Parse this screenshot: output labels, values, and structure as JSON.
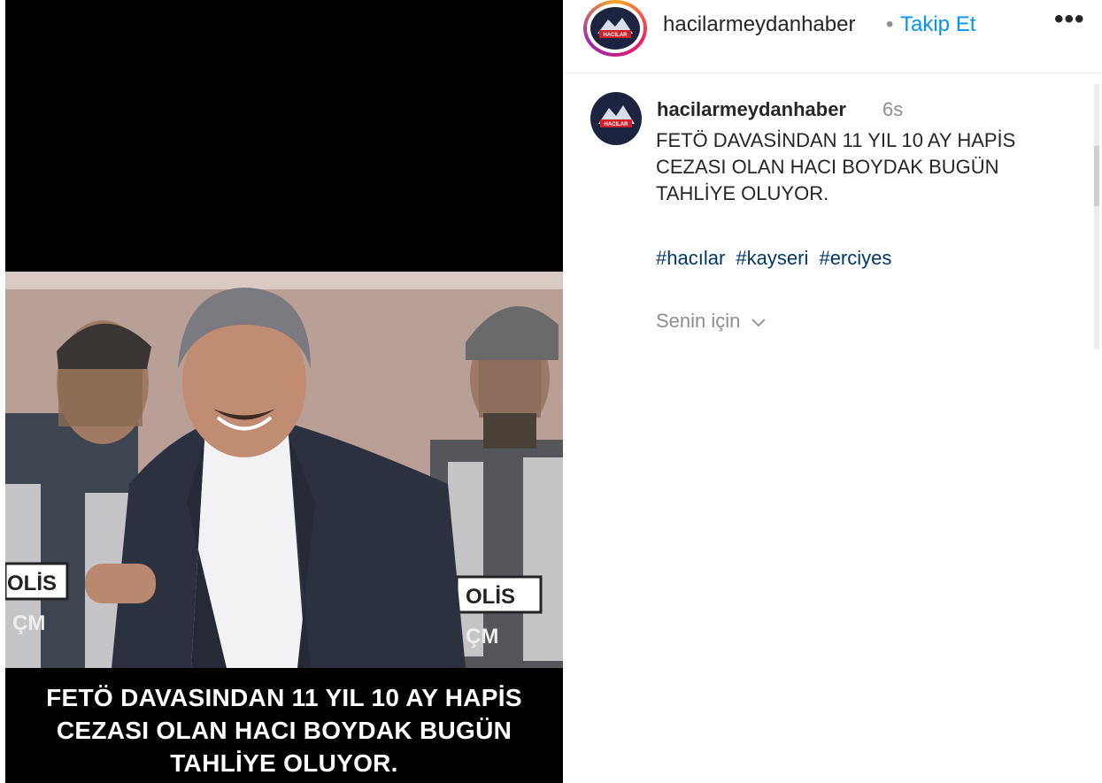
{
  "post": {
    "image_caption_lines": [
      "FETÖ DAVASINDAN 11 YIL 10 AY HAPİS",
      "CEZASI OLAN HACI BOYDAK BUGÜN",
      "TAHLİYE OLUYOR."
    ],
    "vest_text_left": [
      "OLİS",
      "ÇM"
    ],
    "vest_text_right": [
      "OLİS",
      "ÇM"
    ]
  },
  "header": {
    "username": "hacilarmeydanhaber",
    "separator": "•",
    "follow_label": "Takip Et",
    "more_label": "•••",
    "avatar_logo_text": "HACILAR"
  },
  "comment": {
    "username": "hacilarmeydanhaber",
    "time": "6s",
    "text_lines": [
      "FETÖ DAVASİNDAN 11 YIL 10 AY HAPİS",
      "CEZASI OLAN HACI BOYDAK BUGÜN",
      "TAHLİYE OLUYOR."
    ],
    "hashtags": [
      "#hacılar",
      "#kayseri",
      "#erciyes"
    ],
    "footer_label": "Senin için",
    "footer_icon": "chevron-down-icon"
  },
  "colors": {
    "link_blue": "#0095f6",
    "hashtag_blue": "#00376b",
    "muted": "#8e8e8e"
  }
}
